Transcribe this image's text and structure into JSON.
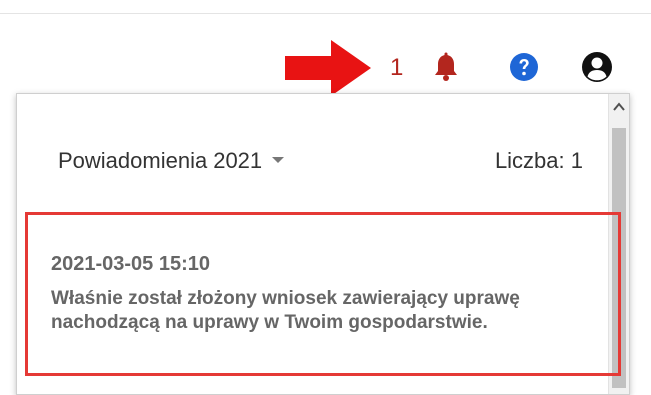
{
  "topbar": {
    "notification_count": "1",
    "icons": {
      "arrow": "red-arrow-icon",
      "bell": "bell-icon",
      "help": "question-circle-icon",
      "user": "user-circle-icon"
    },
    "colors": {
      "arrow": "#e81313",
      "bell": "#b3261e",
      "help": "#1e66d6",
      "user": "#111111",
      "count": "#b3261e"
    }
  },
  "panel": {
    "title": "Powiadomienia",
    "year": "2021",
    "count_label": "Liczba: 1",
    "highlight_color": "#e53935",
    "notifications": [
      {
        "timestamp": "2021-03-05 15:10",
        "message": "Właśnie został złożony wniosek zawierający uprawę nachodzącą na uprawy w Twoim gospodarstwie."
      }
    ]
  }
}
